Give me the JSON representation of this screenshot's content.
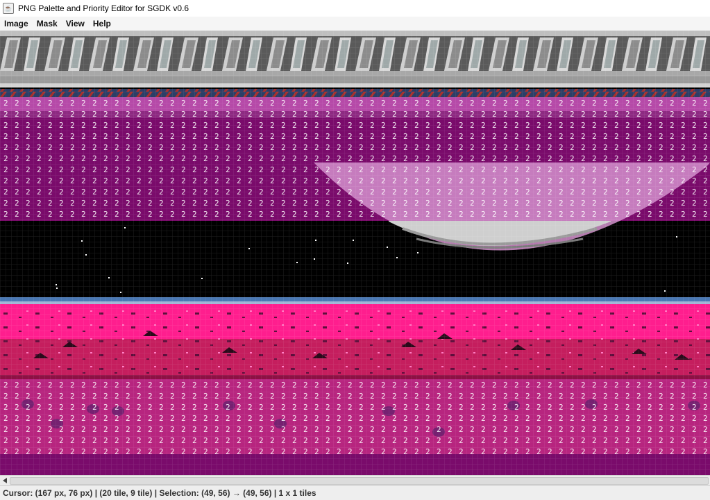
{
  "window": {
    "title": "PNG Palette and Priority Editor for SGDK v0.6",
    "icon": "java-cup-icon"
  },
  "menu": {
    "items": [
      "Image",
      "Mask",
      "View",
      "Help"
    ]
  },
  "canvas": {
    "priority_digit": "2",
    "colors": {
      "black": "#000000",
      "magenta_dark": "#7a0b6b",
      "magenta_light": "#b64aa8",
      "hot_pink": "#ff1e8e",
      "crimson": "#c51e5e",
      "rose": "#d8348a",
      "steel_gray": "#7f7f7f",
      "blue_line": "#4a78b4"
    }
  },
  "status": {
    "text": "Cursor: (167 px, 76 px) | (20 tile, 9 tile) | Selection: (49, 56) → (49, 56) | 1 x 1 tiles"
  }
}
